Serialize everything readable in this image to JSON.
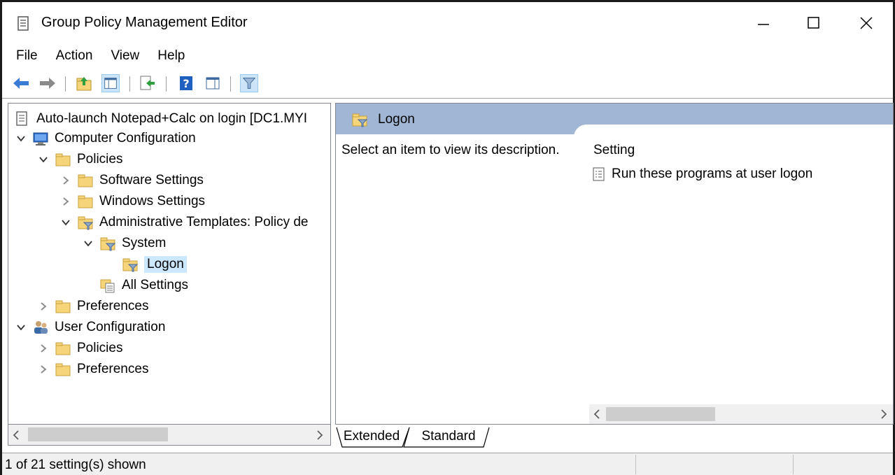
{
  "window": {
    "title": "Group Policy Management Editor"
  },
  "menu": {
    "items": [
      "File",
      "Action",
      "View",
      "Help"
    ]
  },
  "toolbar": {
    "buttons": [
      "back-icon",
      "forward-icon",
      "up-folder-icon",
      "show-hide-tree-icon",
      "export-list-icon",
      "help-icon",
      "show-action-pane-icon",
      "filter-icon"
    ]
  },
  "tree": {
    "root": "Auto-launch Notepad+Calc on login [DC1.MYI",
    "computer_configuration": "Computer Configuration",
    "policies": "Policies",
    "software_settings": "Software Settings",
    "windows_settings": "Windows Settings",
    "admin_templates": "Administrative Templates: Policy de",
    "system": "System",
    "logon": "Logon",
    "all_settings": "All Settings",
    "preferences": "Preferences",
    "user_configuration": "User Configuration",
    "user_policies": "Policies",
    "user_preferences": "Preferences"
  },
  "right": {
    "header_title": "Logon",
    "description": "Select an item to view its description.",
    "column_header": "Setting",
    "settings": [
      "Run these programs at user logon"
    ]
  },
  "tabs": {
    "extended": "Extended",
    "standard": "Standard"
  },
  "status": {
    "text": "1 of 21 setting(s) shown"
  },
  "colors": {
    "header_bg": "#a0b6d4",
    "selection": "#cce8ff",
    "folder": "#f5d47a"
  }
}
